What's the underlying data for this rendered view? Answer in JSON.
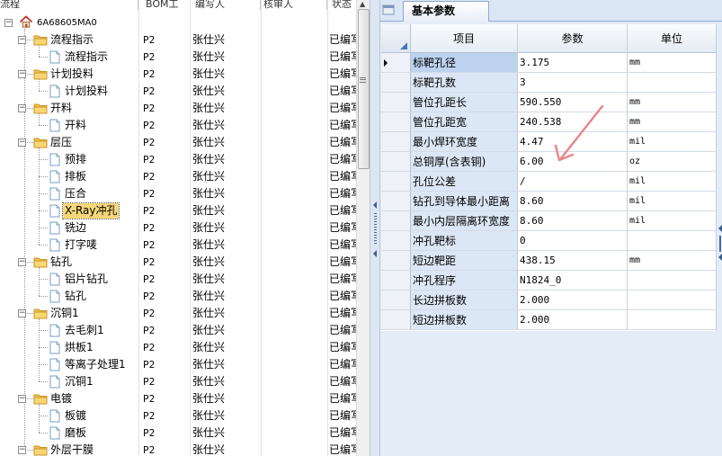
{
  "tree": {
    "columns": {
      "flow": "流程",
      "bom": "BOM工",
      "author": "编写人",
      "reviewer": "核审人",
      "status": "状态"
    },
    "root_label": "6A68605MA0",
    "rows": [
      {
        "label": "流程指示",
        "bom": "P2",
        "author": "张仕兴",
        "status": "已编写"
      },
      {
        "label": "流程指示",
        "bom": "P2",
        "author": "张仕兴",
        "status": "已编写"
      },
      {
        "label": "计划投料",
        "bom": "P2",
        "author": "张仕兴",
        "status": "已编写"
      },
      {
        "label": "计划投料",
        "bom": "P2",
        "author": "张仕兴",
        "status": "已编写"
      },
      {
        "label": "开料",
        "bom": "P2",
        "author": "张仕兴",
        "status": "已编写"
      },
      {
        "label": "开料",
        "bom": "P2",
        "author": "张仕兴",
        "status": "已编写"
      },
      {
        "label": "层压",
        "bom": "P2",
        "author": "张仕兴",
        "status": "已编写"
      },
      {
        "label": "预排",
        "bom": "P2",
        "author": "张仕兴",
        "status": "已编写"
      },
      {
        "label": "排板",
        "bom": "P2",
        "author": "张仕兴",
        "status": "已编写"
      },
      {
        "label": "压合",
        "bom": "P2",
        "author": "张仕兴",
        "status": "已编写"
      },
      {
        "label": "X-Ray冲孔",
        "bom": "P2",
        "author": "张仕兴",
        "status": "已编写"
      },
      {
        "label": "铣边",
        "bom": "P2",
        "author": "张仕兴",
        "status": "已编写"
      },
      {
        "label": "打字唛",
        "bom": "P2",
        "author": "张仕兴",
        "status": "已编写"
      },
      {
        "label": "钻孔",
        "bom": "P2",
        "author": "张仕兴",
        "status": "已编写"
      },
      {
        "label": "铝片钻孔",
        "bom": "P2",
        "author": "张仕兴",
        "status": "已编写"
      },
      {
        "label": "钻孔",
        "bom": "P2",
        "author": "张仕兴",
        "status": "已编写"
      },
      {
        "label": "沉铜1",
        "bom": "P2",
        "author": "张仕兴",
        "status": "已编写"
      },
      {
        "label": "去毛刺1",
        "bom": "P2",
        "author": "张仕兴",
        "status": "已编写"
      },
      {
        "label": "烘板1",
        "bom": "P2",
        "author": "张仕兴",
        "status": "已编写"
      },
      {
        "label": "等离子处理1",
        "bom": "P2",
        "author": "张仕兴",
        "status": "已编写"
      },
      {
        "label": "沉铜1",
        "bom": "P2",
        "author": "张仕兴",
        "status": "已编写"
      },
      {
        "label": "电镀",
        "bom": "P2",
        "author": "张仕兴",
        "status": "已编写"
      },
      {
        "label": "板镀",
        "bom": "P2",
        "author": "张仕兴",
        "status": "已编写"
      },
      {
        "label": "磨板",
        "bom": "P2",
        "author": "张仕兴",
        "status": "已编写"
      },
      {
        "label": "外层干膜",
        "bom": "P2",
        "author": "张仕兴",
        "status": "已编写"
      }
    ],
    "selected_index": 10
  },
  "params_panel": {
    "tab_label": "基本参数",
    "headers": {
      "item": "项目",
      "value": "参数",
      "unit": "单位"
    },
    "rows": [
      {
        "item": "标靶孔径",
        "value": "3.175",
        "unit": "mm"
      },
      {
        "item": "标靶孔数",
        "value": "3",
        "unit": ""
      },
      {
        "item": "管位孔距长",
        "value": "590.550",
        "unit": "mm"
      },
      {
        "item": "管位孔距宽",
        "value": "240.538",
        "unit": "mm"
      },
      {
        "item": "最小焊环宽度",
        "value": "4.47",
        "unit": "mil"
      },
      {
        "item": "总铜厚(含表铜)",
        "value": "6.00",
        "unit": "oz"
      },
      {
        "item": "孔位公差",
        "value": "/",
        "unit": "mil"
      },
      {
        "item": "钻孔到导体最小距离",
        "value": "8.60",
        "unit": "mil"
      },
      {
        "item": "最小内层隔离环宽度",
        "value": "8.60",
        "unit": "mil"
      },
      {
        "item": "冲孔靶标",
        "value": "0",
        "unit": ""
      },
      {
        "item": "短边靶距",
        "value": "438.15",
        "unit": "mm"
      },
      {
        "item": "冲孔程序",
        "value": "N1824_0",
        "unit": ""
      },
      {
        "item": "长边拼板数",
        "value": "2.000",
        "unit": ""
      },
      {
        "item": "短边拼板数",
        "value": "2.000",
        "unit": ""
      }
    ],
    "active_row": 0
  },
  "colors": {
    "annotation_arrow": "#e8878a",
    "selection": "#f5d77a",
    "item_column": "#dce7f6",
    "folder": "#f2c34e"
  }
}
